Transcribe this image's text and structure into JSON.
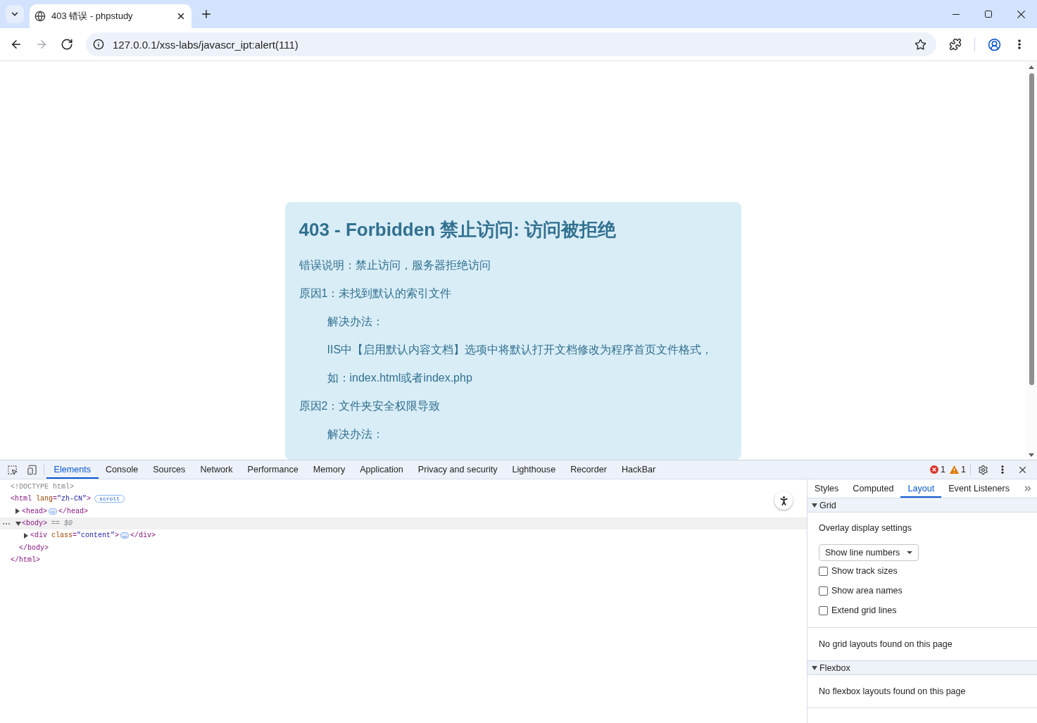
{
  "browser": {
    "tabs": [
      {
        "title": "403 错误 - phpstudy",
        "selected": true
      }
    ],
    "nav_buttons": [
      {
        "kind": "back",
        "disabled": false
      },
      {
        "kind": "forward",
        "disabled": true
      },
      {
        "kind": "reload",
        "disabled": false
      }
    ],
    "url": "127.0.0.1/xss-labs/javascr_ipt:alert(111)"
  },
  "page": {
    "title": "403 - Forbidden 禁止访问: 访问被拒绝",
    "lines": [
      {
        "text": "错误说明：禁止访问，服务器拒绝访问"
      },
      {
        "text": "原因1：未找到默认的索引文件",
        "children": [
          {
            "text": "解决办法："
          },
          {
            "text": "IIS中【启用默认内容文档】选项中将默认打开文档修改为程序首页文件格式，"
          },
          {
            "text": "如：index.html或者index.php"
          }
        ]
      },
      {
        "text": "原因2：文件夹安全权限导致",
        "children": [
          {
            "text": "解决办法："
          }
        ]
      }
    ]
  },
  "devtools": {
    "tabs": [
      {
        "label": "Elements",
        "selected": true
      },
      {
        "label": "Console",
        "selected": false
      },
      {
        "label": "Sources",
        "selected": false
      },
      {
        "label": "Network",
        "selected": false
      },
      {
        "label": "Performance",
        "selected": false
      },
      {
        "label": "Memory",
        "selected": false
      },
      {
        "label": "Application",
        "selected": false
      },
      {
        "label": "Privacy and security",
        "selected": false
      },
      {
        "label": "Lighthouse",
        "selected": false
      },
      {
        "label": "Recorder",
        "selected": false
      },
      {
        "label": "HackBar",
        "selected": false
      }
    ],
    "error_count": "1",
    "warning_count": "1",
    "dom_tree": [
      {
        "kind": "doctype",
        "selected": false,
        "open": [
          {
            "kind": "doctype",
            "text": "<!DOCTYPE html>"
          }
        ]
      },
      {
        "kind": "element",
        "selected": false,
        "open": [
          {
            "kind": "tag",
            "text": "<html"
          },
          {
            "kind": "attr-name",
            "text": " lang"
          },
          {
            "kind": "tag",
            "text": "="
          },
          {
            "kind": "attr-value",
            "text": "\"zh-CN\""
          },
          {
            "kind": "tag",
            "text": ">"
          }
        ],
        "badge": "scroll",
        "children": [
          {
            "kind": "element",
            "expanded": false,
            "selected": false,
            "open": [
              {
                "kind": "tag",
                "text": "<head>"
              }
            ],
            "ellipsis": "…",
            "close": [
              {
                "kind": "tag",
                "text": "</head>"
              }
            ]
          },
          {
            "kind": "element",
            "expanded": true,
            "selected": true,
            "open": [
              {
                "kind": "tag",
                "text": "<body>"
              }
            ],
            "suffix": "== $0",
            "children": [
              {
                "kind": "element",
                "expanded": false,
                "selected": false,
                "open": [
                  {
                    "kind": "tag",
                    "text": "<div"
                  },
                  {
                    "kind": "attr-name",
                    "text": " class"
                  },
                  {
                    "kind": "tag",
                    "text": "="
                  },
                  {
                    "kind": "attr-value",
                    "text": "\"content\""
                  },
                  {
                    "kind": "tag",
                    "text": ">"
                  }
                ],
                "ellipsis": "…",
                "close": [
                  {
                    "kind": "tag",
                    "text": "</div>"
                  }
                ]
              }
            ],
            "close": [
              {
                "kind": "tag",
                "text": "</body>"
              }
            ]
          }
        ],
        "close": [
          {
            "kind": "tag",
            "text": "</html>"
          }
        ]
      }
    ],
    "sidebar": {
      "tabs": [
        {
          "label": "Styles",
          "selected": false
        },
        {
          "label": "Computed",
          "selected": false
        },
        {
          "label": "Layout",
          "selected": true
        },
        {
          "label": "Event Listeners",
          "selected": false
        }
      ],
      "sections": [
        {
          "title": "Grid",
          "expanded": true,
          "heading": "Overlay display settings",
          "select_value": "Show line numbers",
          "options": [
            {
              "label": "Show track sizes",
              "checked": false
            },
            {
              "label": "Show area names",
              "checked": false
            },
            {
              "label": "Extend grid lines",
              "checked": false
            }
          ],
          "message": "No grid layouts found on this page"
        },
        {
          "title": "Flexbox",
          "expanded": true,
          "message": "No flexbox layouts found on this page"
        }
      ]
    }
  }
}
